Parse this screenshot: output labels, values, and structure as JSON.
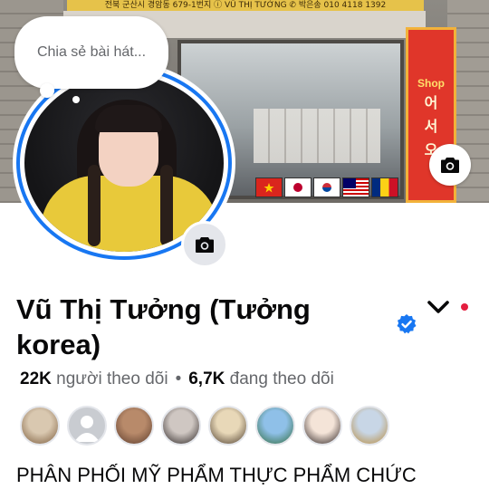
{
  "cover": {
    "sign_text": "전북 군산시 경암동 679-1번지  ⓘ VŨ THỊ TƯỞNG  ✆ 박은송 010 4118 1392",
    "banner_lines": [
      "Shop",
      "어",
      "서",
      "오"
    ]
  },
  "note": {
    "placeholder": "Chia sẻ bài hát..."
  },
  "profile": {
    "name": "Vũ Thị Tưởng (Tưởng korea)",
    "verified": true,
    "followers_count": "22K",
    "followers_label": "người theo dõi",
    "following_count": "6,7K",
    "following_label": "đang theo dõi",
    "separator": "•",
    "bio": "PHÂN PHỐI MỸ PHẨM THỰC PHẨM CHỨC"
  },
  "friends": [
    {
      "id": "friend-1",
      "colors": [
        "#d9c8b0",
        "#7a5a3a"
      ]
    },
    {
      "id": "friend-2",
      "colors": [
        "#c9ccd1",
        "#8a8d91"
      ]
    },
    {
      "id": "friend-3",
      "colors": [
        "#b88a6a",
        "#5a3a2a"
      ]
    },
    {
      "id": "friend-4",
      "colors": [
        "#cfc7c2",
        "#2a2322"
      ]
    },
    {
      "id": "friend-5",
      "colors": [
        "#e8d8b8",
        "#4a3a2a"
      ]
    },
    {
      "id": "friend-6",
      "colors": [
        "#8fc0e8",
        "#2e6a3a"
      ]
    },
    {
      "id": "friend-7",
      "colors": [
        "#f4e4d8",
        "#2a2020"
      ]
    },
    {
      "id": "friend-8",
      "colors": [
        "#c8d6e6",
        "#b88a3a"
      ]
    }
  ],
  "colors": {
    "accent": "#1877f2",
    "text_primary": "#080809",
    "text_secondary": "#65676b",
    "notification": "#e41e3f"
  },
  "icons": {
    "cover_camera": "camera-icon",
    "avatar_camera": "camera-icon",
    "verified": "verified-badge-icon",
    "menu": "chevron-down-icon"
  }
}
